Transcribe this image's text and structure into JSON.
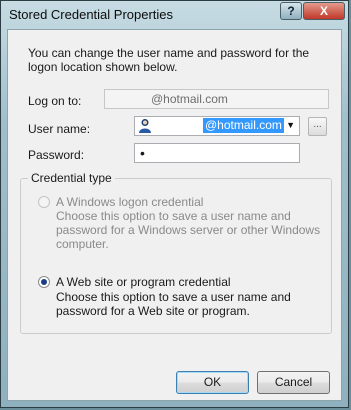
{
  "window": {
    "title": "Stored Credential Properties",
    "help_glyph": "?",
    "close_glyph": "X"
  },
  "intro": "You can change the user name and password for the logon location shown below.",
  "logon": {
    "label": "Log on to:",
    "value": "@hotmail.com"
  },
  "username": {
    "label": "User name:",
    "value": "@hotmail.com",
    "browse_label": "..."
  },
  "password": {
    "label": "Password:",
    "value": "•"
  },
  "credential_type": {
    "title": "Credential type",
    "windows": {
      "label": "A Windows logon credential",
      "description": "Choose this option to save a user name and password for a Windows server or other Windows computer.",
      "enabled": false,
      "checked": false
    },
    "web": {
      "label": "A Web site or program credential",
      "description": "Choose this option to save a user name and password for a Web site or program.",
      "enabled": true,
      "checked": true
    }
  },
  "buttons": {
    "ok": "OK",
    "cancel": "Cancel"
  }
}
